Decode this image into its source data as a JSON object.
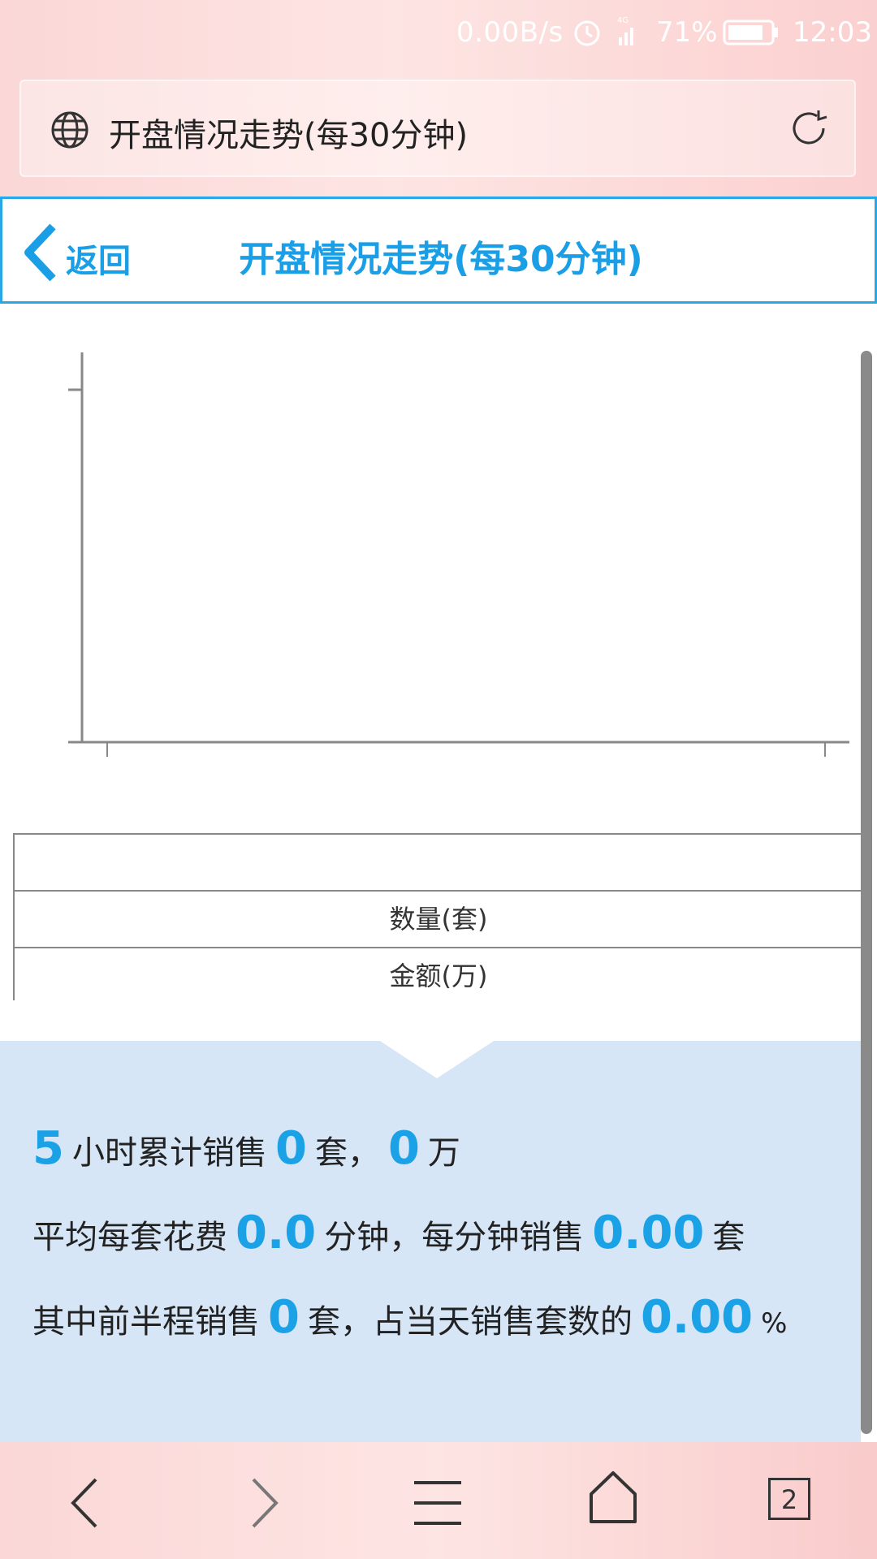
{
  "status_bar": {
    "net_speed": "0.00B/s",
    "network": "4G",
    "battery": "71%",
    "time": "12:03"
  },
  "browser": {
    "url_title": "开盘情况走势(每30分钟)",
    "tab_count": "2"
  },
  "header": {
    "back_label": "返回",
    "title": "开盘情况走势(每30分钟)"
  },
  "table": {
    "rows": [
      "",
      "数量(套)",
      "金额(万)"
    ]
  },
  "summary": {
    "line1": {
      "hours": "5",
      "t1": "小时累计销售",
      "sets": "0",
      "t2": "套，",
      "amount": "0",
      "t3": "万"
    },
    "line2": {
      "t1": "平均每套花费",
      "minutes": "0.0",
      "t2": "分钟，每分钟销售",
      "per_min": "0.00",
      "t3": "套"
    },
    "line3": {
      "t1": "其中前半程销售",
      "first_half": "0",
      "t2": "套，占当天销售套数的",
      "pct": "0.00",
      "t3": "%"
    }
  },
  "colors": {
    "accent": "#1a9fe6",
    "summary_bg": "#d6e6f6",
    "browser_bg": "#fbd7d7"
  }
}
